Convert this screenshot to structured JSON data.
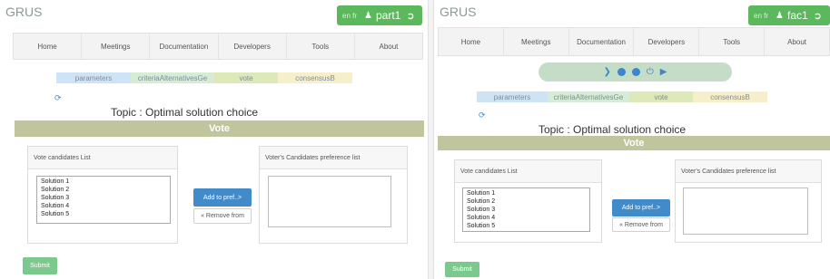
{
  "brand": "GRUS",
  "nav": [
    "Home",
    "Meetings",
    "Documentation",
    "Developers",
    "Tools",
    "About"
  ],
  "lang": "en fr",
  "tabs": [
    "parameters",
    "criteriaAlternativesGe",
    "vote",
    "consensusB"
  ],
  "topic": "Topic : Optimal solution choice",
  "vote_title": "Vote",
  "candidates_header": "Vote candidates List",
  "preference_header": "Voter's Candidates preference list",
  "candidates": [
    "Solution 1",
    "Solution 2",
    "Solution 3",
    "Solution 4",
    "Solution 5"
  ],
  "add_button": "Add to pref..>",
  "remove_button": "« Remove from",
  "submit_button": "Submit",
  "left": {
    "user": "part1"
  },
  "right": {
    "user": "fac1"
  },
  "colors": {
    "user_badge": "#5cb85c",
    "vote_bar": "#c1c59e",
    "tab_parameters": "#cfe3f6",
    "tab_criteria": "#d6ecd4",
    "tab_vote": "#dde9b8",
    "tab_consensus": "#f7efc9",
    "add_button": "#428bca",
    "submit_button": "#7cc98e"
  }
}
